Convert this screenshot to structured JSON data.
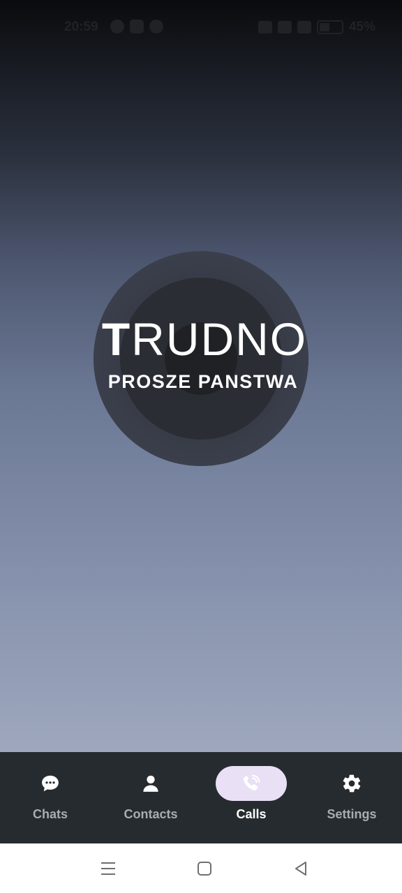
{
  "status_bar": {
    "time": "20:59",
    "battery_percent": "45%",
    "app_icons": [
      "messenger-icon",
      "instagram-icon",
      "app-icon"
    ],
    "system_icons": [
      "vibrate-icon",
      "wifi-icon",
      "signal-icon",
      "battery-icon"
    ]
  },
  "profile": {
    "logo_title_first": "T",
    "logo_title_rest": "RUDNO",
    "logo_subtitle": "PROSZE PANSTWA"
  },
  "bottom_nav": {
    "items": [
      {
        "label": "Chats",
        "icon": "chat-bubble-icon",
        "active": false
      },
      {
        "label": "Contacts",
        "icon": "person-icon",
        "active": false
      },
      {
        "label": "Calls",
        "icon": "phone-icon",
        "active": true
      },
      {
        "label": "Settings",
        "icon": "gear-icon",
        "active": false
      }
    ]
  },
  "system_nav": {
    "buttons": [
      "recents-icon",
      "home-icon",
      "back-icon"
    ]
  },
  "colors": {
    "nav_background": "#262b2f",
    "nav_active_pill": "#e9e0f6",
    "nav_inactive_text": "#a8adb3",
    "nav_active_text": "#ffffff"
  }
}
